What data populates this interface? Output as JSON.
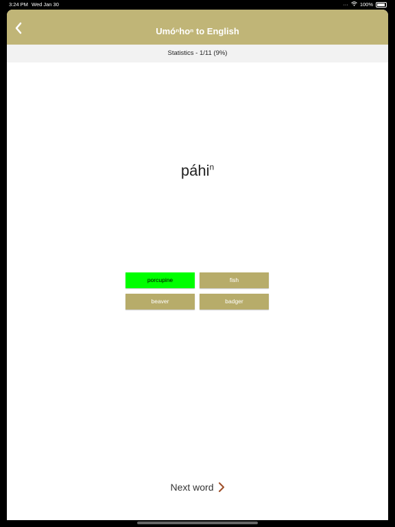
{
  "status_bar": {
    "time": "3:24 PM",
    "date": "Wed Jan 30",
    "battery": "100%"
  },
  "nav": {
    "title_prefix": "Umóⁿhoⁿ",
    "title_suffix": " to English",
    "back_icon": "chevron-left-icon"
  },
  "stats": {
    "text": "Statistics - 1/11 (9%)"
  },
  "word": {
    "base": "páhi",
    "superscript": "n"
  },
  "answers": [
    {
      "label": "porcupine",
      "state": "correct"
    },
    {
      "label": "fish",
      "state": "default"
    },
    {
      "label": "beaver",
      "state": "default"
    },
    {
      "label": "badger",
      "state": "default"
    }
  ],
  "next": {
    "label": "Next word",
    "icon": "chevron-right-icon"
  },
  "colors": {
    "accent": "#c0b577",
    "button": "#b7ac6a",
    "correct": "#00ff00",
    "chevron": "#a0522d"
  }
}
